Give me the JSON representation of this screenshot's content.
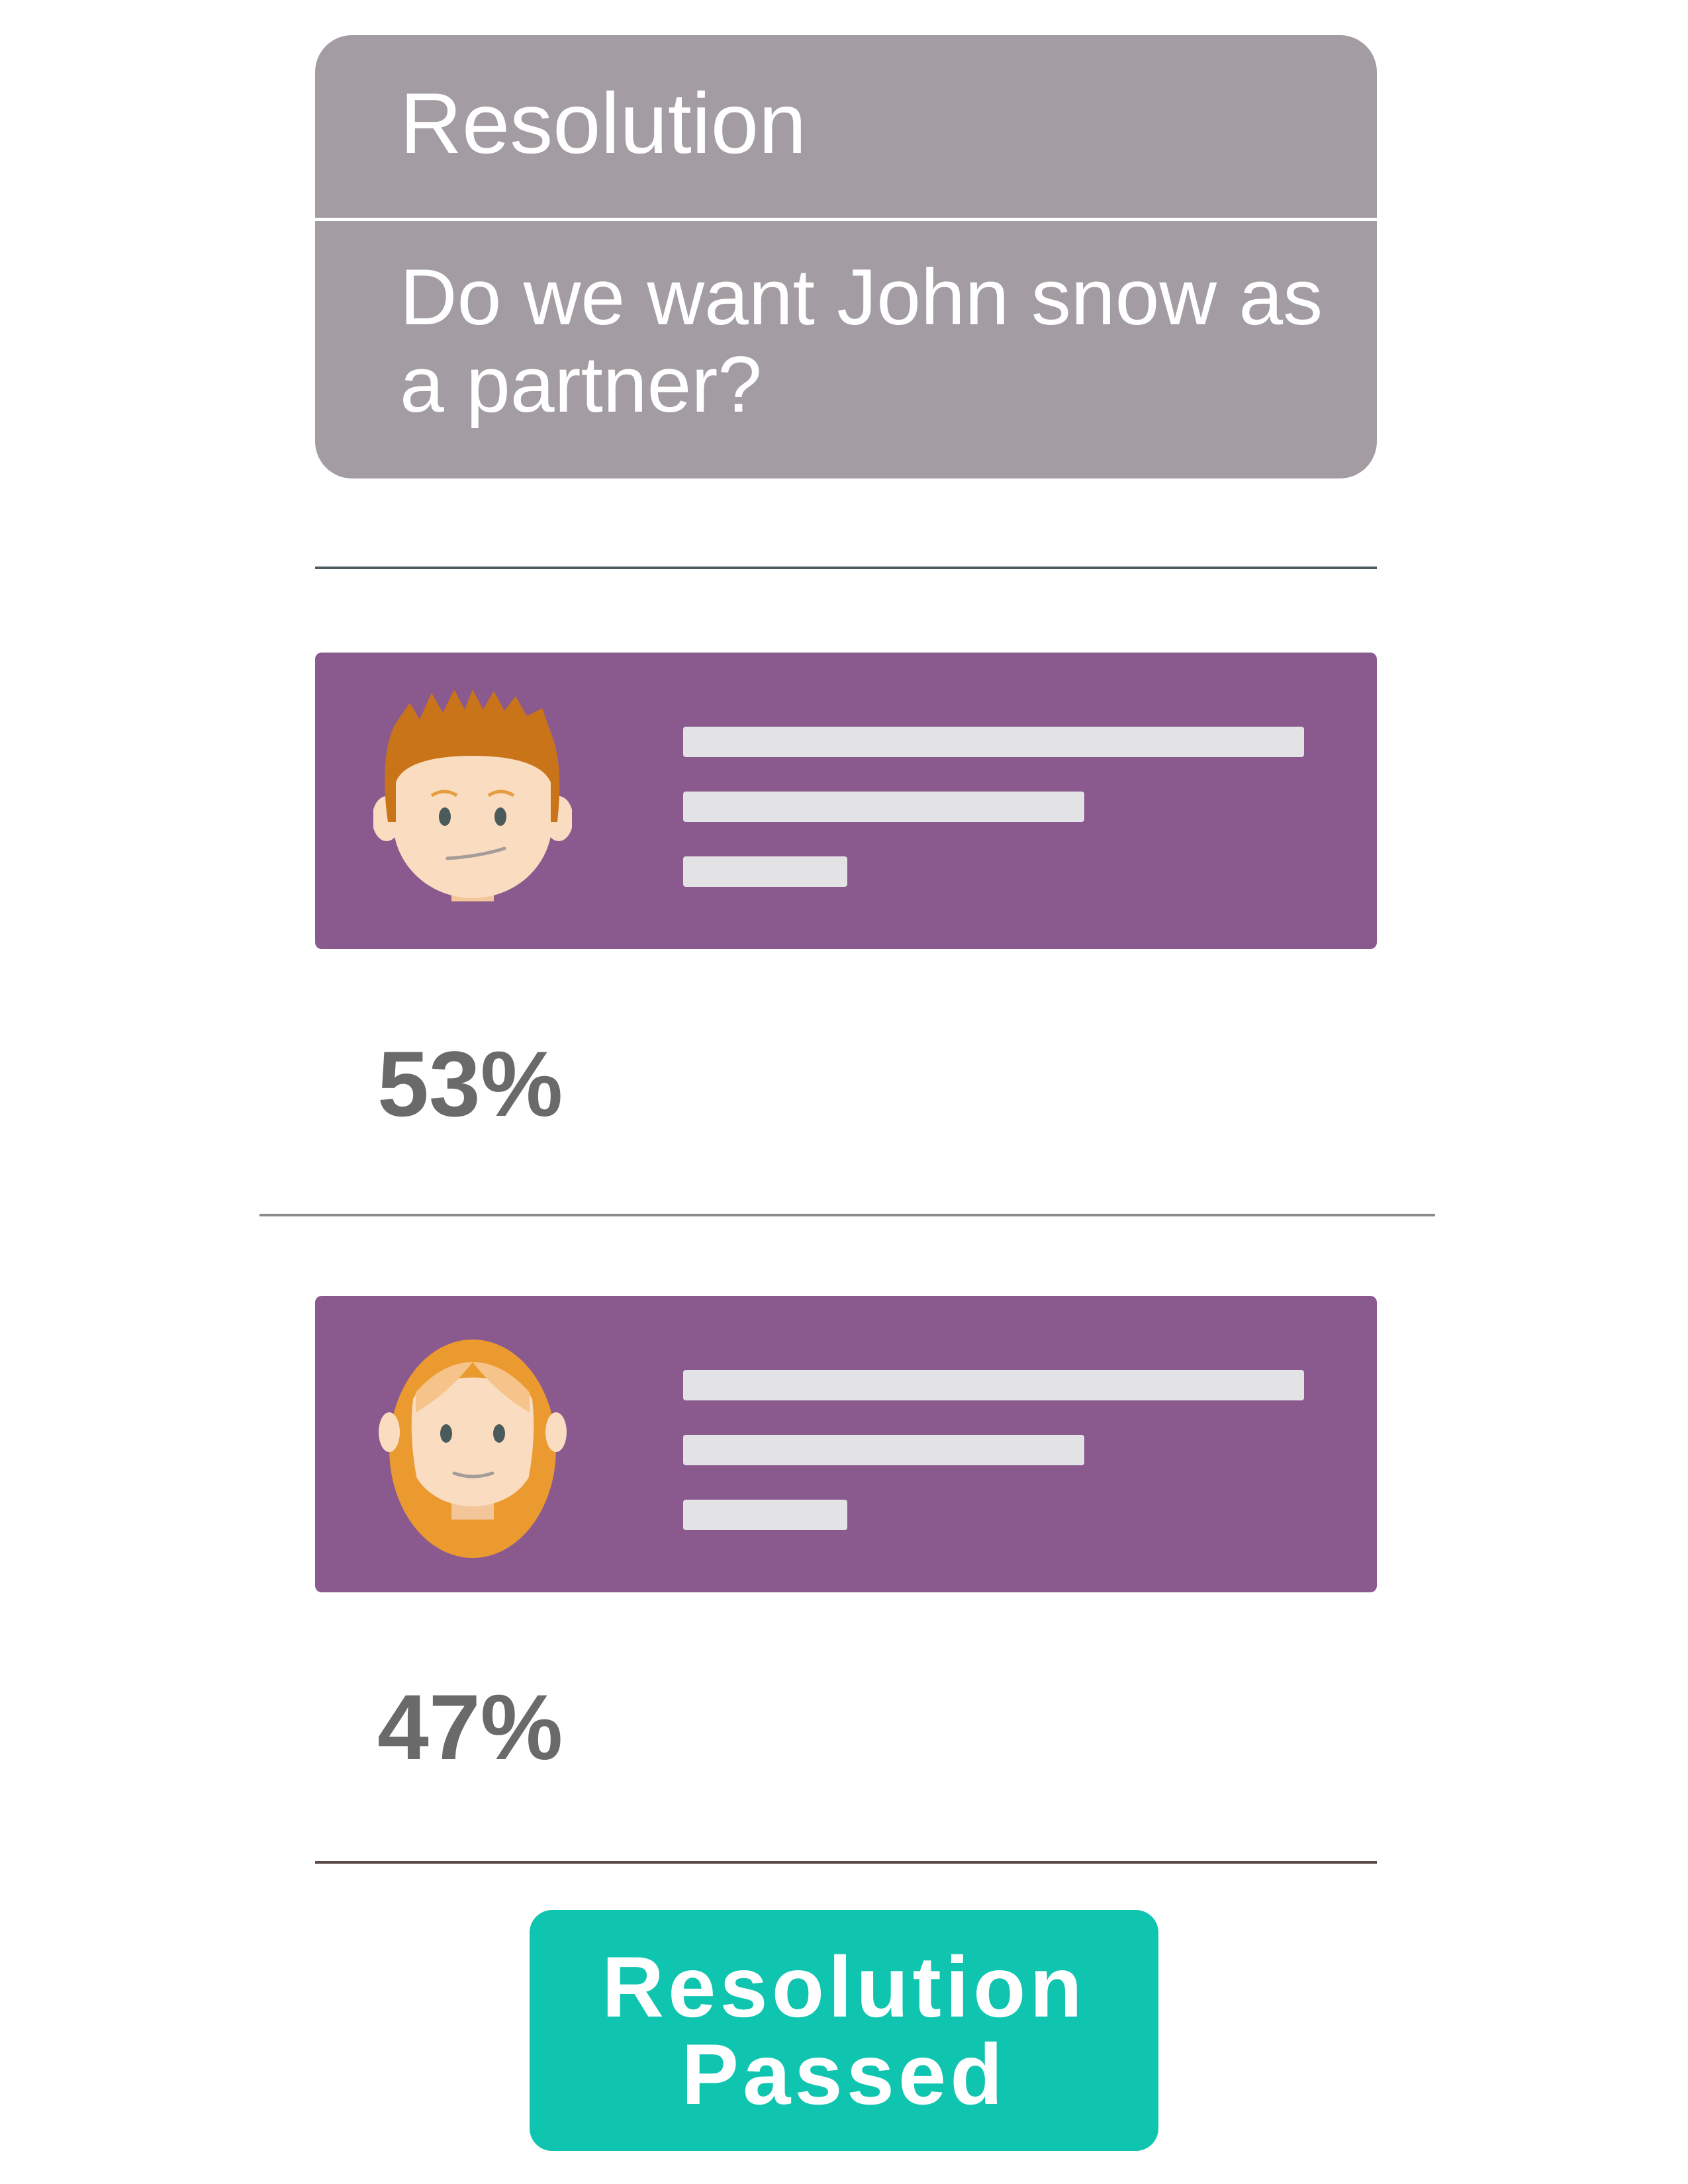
{
  "resolution_card": {
    "title": "Resolution",
    "question": "Do we want John snow as a partner?"
  },
  "options": [
    {
      "avatar": "male-avatar-icon",
      "percentage": "53%",
      "share": 0.53
    },
    {
      "avatar": "female-avatar-icon",
      "percentage": "47%",
      "share": 0.47
    }
  ],
  "result_button": {
    "line1": "Resolution",
    "line2": "Passed"
  },
  "colors": {
    "card_background": "#a39ca2",
    "option_background": "#8a5a8f",
    "placeholder_bar": "#e3e2e5",
    "percentage_text": "#6a6a6a",
    "button_background": "#10c5b0",
    "male_hair": "#c97418",
    "female_hair": "#eb9a30",
    "skin": "#fadcc0"
  }
}
